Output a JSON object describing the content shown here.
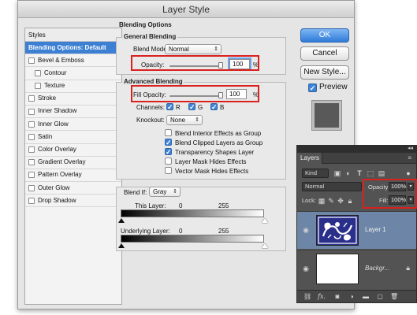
{
  "dialog": {
    "title": "Layer Style",
    "styles_header": "Styles",
    "styles": [
      {
        "label": "Blending Options: Default",
        "selected": true,
        "checkbox": false
      },
      {
        "label": "Bevel & Emboss",
        "checkbox": true
      },
      {
        "label": "Contour",
        "checkbox": true,
        "sub": true
      },
      {
        "label": "Texture",
        "checkbox": true,
        "sub": true
      },
      {
        "label": "Stroke",
        "checkbox": true
      },
      {
        "label": "Inner Shadow",
        "checkbox": true
      },
      {
        "label": "Inner Glow",
        "checkbox": true
      },
      {
        "label": "Satin",
        "checkbox": true
      },
      {
        "label": "Color Overlay",
        "checkbox": true
      },
      {
        "label": "Gradient Overlay",
        "checkbox": true
      },
      {
        "label": "Pattern Overlay",
        "checkbox": true
      },
      {
        "label": "Outer Glow",
        "checkbox": true
      },
      {
        "label": "Drop Shadow",
        "checkbox": true
      }
    ],
    "blending_options_title": "Blending Options",
    "general": {
      "legend": "General Blending",
      "blend_mode_label": "Blend Mode:",
      "blend_mode_value": "Normal",
      "opacity_label": "Opacity:",
      "opacity_value": "100",
      "opacity_unit": "%"
    },
    "advanced": {
      "legend": "Advanced Blending",
      "fill_opacity_label": "Fill Opacity:",
      "fill_opacity_value": "100",
      "fill_opacity_unit": "%",
      "channels_label": "Channels:",
      "channel_r": "R",
      "channel_g": "G",
      "channel_b": "B",
      "knockout_label": "Knockout:",
      "knockout_value": "None",
      "options": [
        {
          "label": "Blend Interior Effects as Group",
          "checked": false
        },
        {
          "label": "Blend Clipped Layers as Group",
          "checked": true
        },
        {
          "label": "Transparency Shapes Layer",
          "checked": true
        },
        {
          "label": "Layer Mask Hides Effects",
          "checked": false
        },
        {
          "label": "Vector Mask Hides Effects",
          "checked": false
        }
      ]
    },
    "blend_if": {
      "label": "Blend If:",
      "value": "Gray",
      "this_layer_label": "This Layer:",
      "this_layer_low": "0",
      "this_layer_high": "255",
      "underlying_label": "Underlying Layer:",
      "underlying_low": "0",
      "underlying_high": "255"
    },
    "buttons": {
      "ok": "OK",
      "cancel": "Cancel",
      "new_style": "New Style...",
      "preview": "Preview"
    },
    "swatch_color": "#595959",
    "highlight_color": "#d9211e"
  },
  "layers_panel": {
    "collapse_glyph": "◂◂",
    "tab": "Layers",
    "menu_glyph": "≡",
    "kind_label": "Kind",
    "blend_mode": "Normal",
    "opacity_label": "Opacity:",
    "opacity_value": "100%",
    "lock_label": "Lock:",
    "fill_label": "Fill:",
    "fill_value": "100%",
    "layers": [
      {
        "name": "Layer 1",
        "selected": true
      },
      {
        "name": "Backgr...",
        "selected": false,
        "locked": true
      }
    ],
    "bottom_fx": "fx."
  }
}
